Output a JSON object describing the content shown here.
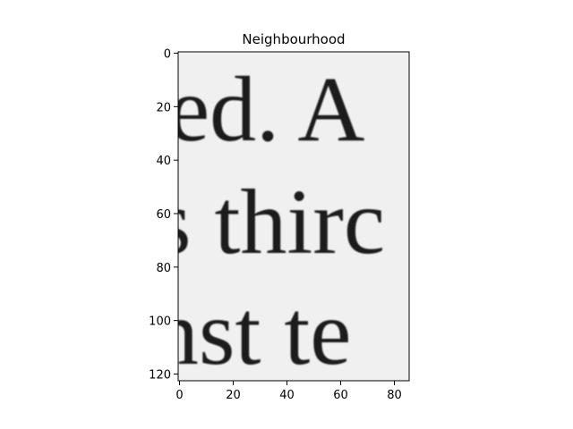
{
  "chart_data": {
    "type": "image",
    "title": "Neighbourhood",
    "xlabel": "",
    "ylabel": "",
    "xlim": [
      -0.5,
      85.5
    ],
    "ylim": [
      122.5,
      -0.5
    ],
    "x_ticks": [
      0,
      20,
      40,
      60,
      80
    ],
    "y_ticks": [
      0,
      20,
      40,
      60,
      80,
      100,
      120
    ],
    "colormap": "gray",
    "background_color": "#f0f0f0",
    "ink_color": "#1e1e1e",
    "text_rows": [
      "ed.  A",
      "s  thirc",
      "nst  te"
    ]
  }
}
